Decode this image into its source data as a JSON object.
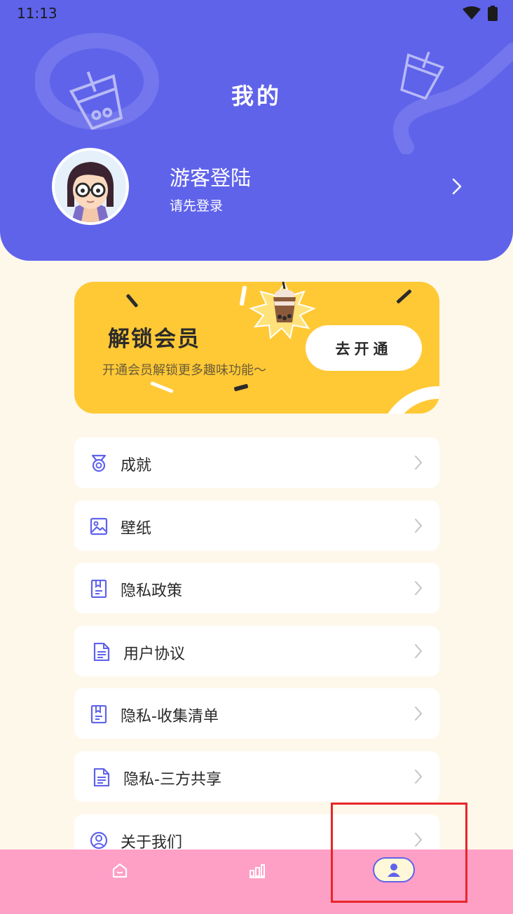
{
  "status_bar": {
    "time": "11:13"
  },
  "header": {
    "title": "我的",
    "user_name": "游客登陆",
    "user_sub": "请先登录"
  },
  "vip": {
    "title": "解锁会员",
    "subtitle": "开通会员解锁更多趣味功能～",
    "button": "去开通"
  },
  "menu": {
    "items": [
      {
        "label": "成就",
        "icon": "medal-icon"
      },
      {
        "label": "壁纸",
        "icon": "image-icon"
      },
      {
        "label": "隐私政策",
        "icon": "document-bookmark-icon"
      },
      {
        "label": "用户协议",
        "icon": "document-icon"
      },
      {
        "label": "隐私-收集清单",
        "icon": "document-bookmark-icon"
      },
      {
        "label": "隐私-三方共享",
        "icon": "document-icon"
      },
      {
        "label": "关于我们",
        "icon": "user-circle-icon"
      }
    ]
  },
  "tabbar": {
    "tabs": [
      {
        "name": "home",
        "icon": "home-icon",
        "active": false
      },
      {
        "name": "stats",
        "icon": "bar-chart-icon",
        "active": false
      },
      {
        "name": "profile",
        "icon": "user-icon",
        "active": true
      }
    ]
  },
  "colors": {
    "primary": "#5f63ea",
    "background": "#fdf8ea",
    "vip_yellow": "#ffc936",
    "tabbar_pink": "#fe9fc6",
    "highlight_red": "#e8262a"
  }
}
